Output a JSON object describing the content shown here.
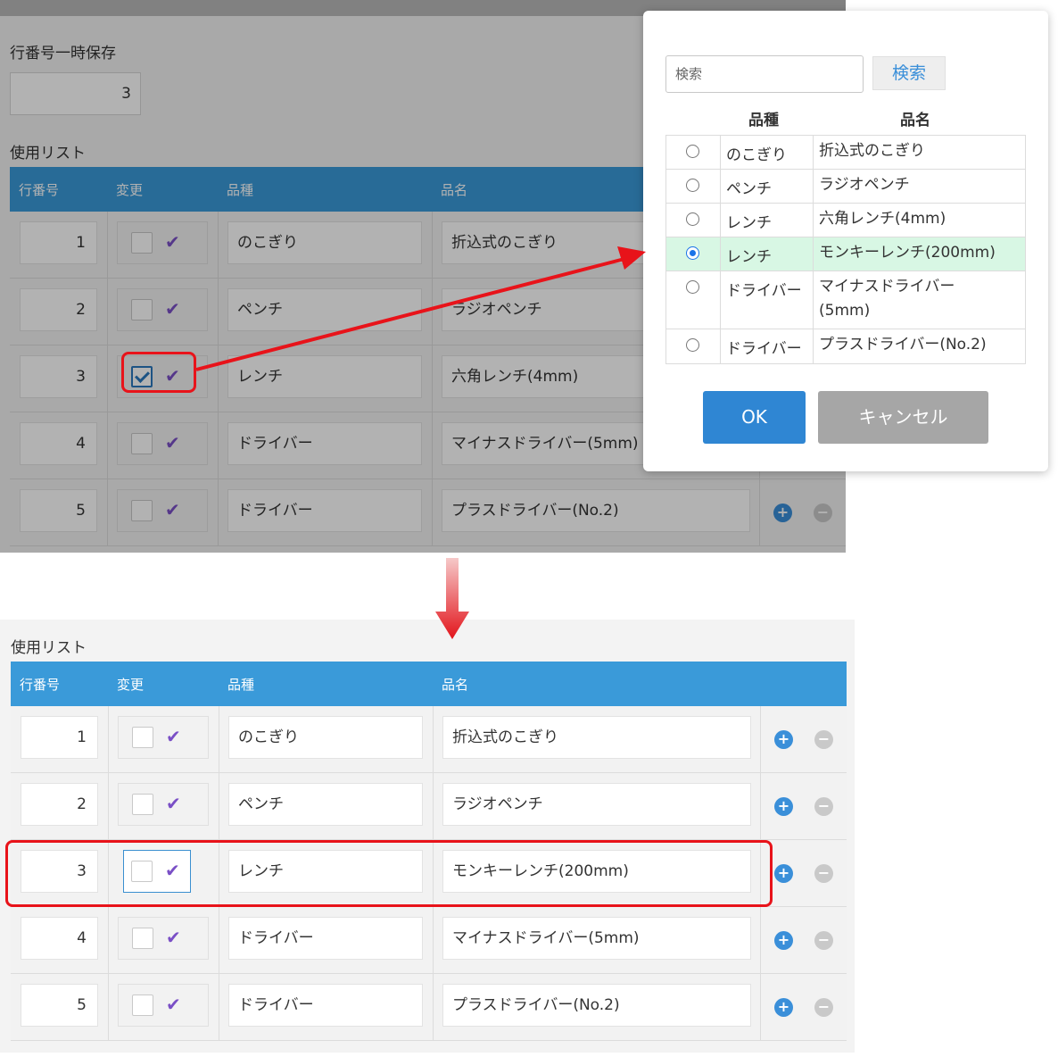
{
  "top": {
    "temp_label": "行番号一時保存",
    "temp_value": "3",
    "list_title": "使用リスト",
    "headers": [
      "行番号",
      "変更",
      "品種",
      "品名"
    ],
    "rows": [
      {
        "no": "1",
        "kind": "のこぎり",
        "name": "折込式のこぎり",
        "checked": false
      },
      {
        "no": "2",
        "kind": "ペンチ",
        "name": "ラジオペンチ",
        "checked": false
      },
      {
        "no": "3",
        "kind": "レンチ",
        "name": "六角レンチ(4mm)",
        "checked": true
      },
      {
        "no": "4",
        "kind": "ドライバー",
        "name": "マイナスドライバー(5mm)",
        "checked": false
      },
      {
        "no": "5",
        "kind": "ドライバー",
        "name": "プラスドライバー(No.2)",
        "checked": false
      }
    ]
  },
  "modal": {
    "search_placeholder": "検索",
    "search_button": "検索",
    "col_kind": "品種",
    "col_name": "品名",
    "items": [
      {
        "kind": "のこぎり",
        "name": "折込式のこぎり",
        "selected": false
      },
      {
        "kind": "ペンチ",
        "name": "ラジオペンチ",
        "selected": false
      },
      {
        "kind": "レンチ",
        "name": "六角レンチ(4mm)",
        "selected": false
      },
      {
        "kind": "レンチ",
        "name": "モンキーレンチ(200mm)",
        "selected": true
      },
      {
        "kind": "ドライバー",
        "name": "マイナスドライバー(5mm)",
        "selected": false
      },
      {
        "kind": "ドライバー",
        "name": "プラスドライバー(No.2)",
        "selected": false
      }
    ],
    "ok_label": "OK",
    "cancel_label": "キャンセル"
  },
  "bottom": {
    "list_title": "使用リスト",
    "headers": [
      "行番号",
      "変更",
      "品種",
      "品名"
    ],
    "rows": [
      {
        "no": "1",
        "kind": "のこぎり",
        "name": "折込式のこぎり"
      },
      {
        "no": "2",
        "kind": "ペンチ",
        "name": "ラジオペンチ"
      },
      {
        "no": "3",
        "kind": "レンチ",
        "name": "モンキーレンチ(200mm)"
      },
      {
        "no": "4",
        "kind": "ドライバー",
        "name": "マイナスドライバー(5mm)"
      },
      {
        "no": "5",
        "kind": "ドライバー",
        "name": "プラスドライバー(No.2)"
      }
    ],
    "add_symbol": "+",
    "remove_symbol": "−"
  },
  "colors": {
    "header_blue": "#3a9ad9",
    "highlight_red": "#e8131a",
    "selected_row": "#d8f7e4"
  }
}
